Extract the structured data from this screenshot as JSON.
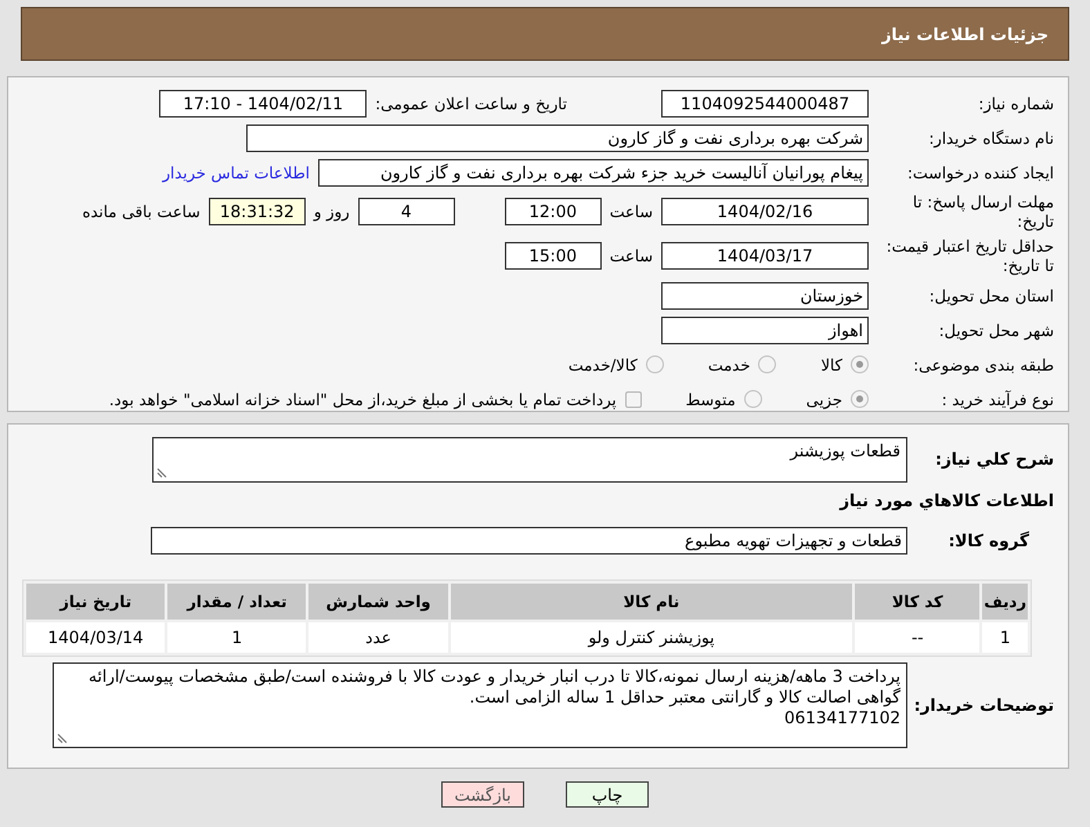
{
  "header": {
    "title": "جزئیات اطلاعات نیاز"
  },
  "details": {
    "need_number": {
      "label": "شماره نیاز:",
      "value": "1104092544000487"
    },
    "announce": {
      "label": "تاریخ و ساعت اعلان عمومی:",
      "value": "1404/02/11 - 17:10"
    },
    "buyer": {
      "label": "نام دستگاه خریدار:",
      "value": "شرکت بهره برداری نفت و گاز کارون"
    },
    "creator": {
      "label": "ایجاد کننده درخواست:",
      "value": "پیغام پورانیان آنالیست خرید جزء شرکت بهره برداری نفت و گاز کارون",
      "link": "اطلاعات تماس خریدار"
    },
    "deadline": {
      "label": "مهلت ارسال پاسخ: تا تاریخ:",
      "date": "1404/02/16",
      "time_label": "ساعت",
      "time": "12:00",
      "days": "4",
      "days_label": "روز و",
      "remaining": "18:31:32",
      "remaining_label": "ساعت باقی مانده"
    },
    "validity": {
      "label": "حداقل تاریخ اعتبار قیمت: تا تاریخ:",
      "date": "1404/03/17",
      "time_label": "ساعت",
      "time": "15:00"
    },
    "province": {
      "label": "استان محل تحویل:",
      "value": "خوزستان"
    },
    "city": {
      "label": "شهر محل تحویل:",
      "value": "اهواز"
    },
    "category": {
      "label": "طبقه بندی موضوعی:",
      "options": [
        {
          "label": "کالا",
          "selected": true
        },
        {
          "label": "خدمت",
          "selected": false
        },
        {
          "label": "کالا/خدمت",
          "selected": false
        }
      ]
    },
    "process": {
      "label": "نوع فرآیند خرید :",
      "options": [
        {
          "label": "جزیی",
          "selected": true
        },
        {
          "label": "متوسط",
          "selected": false
        }
      ],
      "payment": {
        "label": "پرداخت تمام یا بخشی از مبلغ خرید،از محل \"اسناد خزانه اسلامی\" خواهد بود.",
        "checked": false
      }
    }
  },
  "needs": {
    "description": {
      "label": "شرح کلي نیاز:",
      "value": "قطعات پوزیشنر"
    },
    "goods_heading": "اطلاعات کالاهاي مورد نیاز",
    "group": {
      "label": "گروه کالا:",
      "value": "قطعات و تجهیزات تهویه مطبوع"
    },
    "table": {
      "columns": [
        "ردیف",
        "کد کالا",
        "نام کالا",
        "واحد شمارش",
        "تعداد / مقدار",
        "تاریخ نیاز"
      ],
      "rows": [
        [
          "1",
          "--",
          "پوزیشنر کنترل ولو",
          "عدد",
          "1",
          "1404/03/14"
        ]
      ]
    },
    "buyer_notes": {
      "label": "توضیحات خریدار:",
      "value": "پرداخت 3 ماهه/هزینه ارسال نمونه،کالا تا درب انبار خریدار و عودت کالا با فروشنده است/طبق مشخصات پیوست/ارائه گواهی اصالت کالا و گارانتی معتبر حداقل 1 ساله الزامی است.\n06134177102"
    }
  },
  "buttons": [
    {
      "kind": "print",
      "label": "چاپ"
    },
    {
      "kind": "back",
      "label": "بازگشت"
    }
  ]
}
